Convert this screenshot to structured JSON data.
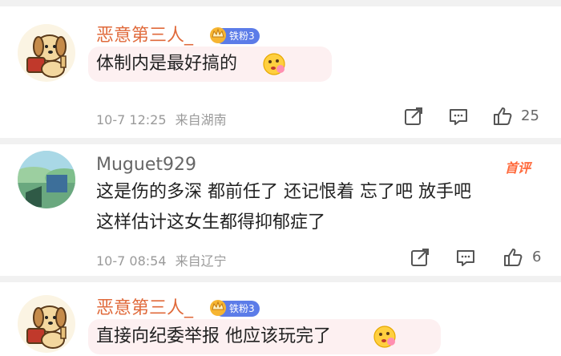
{
  "comments": [
    {
      "username": "恶意第三人_",
      "badge": "铁粉3",
      "text": "体制内是最好搞的",
      "time": "10-7 12:25",
      "location": "来自湖南",
      "likes": "25",
      "name_color": "#e06a3b",
      "avatar_icon": "cartoon-dog-avatar",
      "emoji": "thinking-emoji"
    },
    {
      "username": "Muguet929",
      "tag": "首评",
      "text_lines": [
        "这是伤的多深 都前任了 还记恨着  忘了吧 放手吧",
        "这样估计这女生都得抑郁症了"
      ],
      "time": "10-7 08:54",
      "location": "来自辽宁",
      "likes": "6",
      "name_color": "#666666",
      "avatar_icon": "landscape-avatar"
    },
    {
      "username": "恶意第三人_",
      "badge": "铁粉3",
      "text": "直接向纪委举报 他应该玩完了",
      "name_color": "#e06a3b",
      "avatar_icon": "cartoon-dog-avatar",
      "emoji": "thinking-emoji"
    }
  ],
  "icons": {
    "share": "share-icon",
    "comment": "comment-icon",
    "like": "thumbs-up-icon"
  }
}
